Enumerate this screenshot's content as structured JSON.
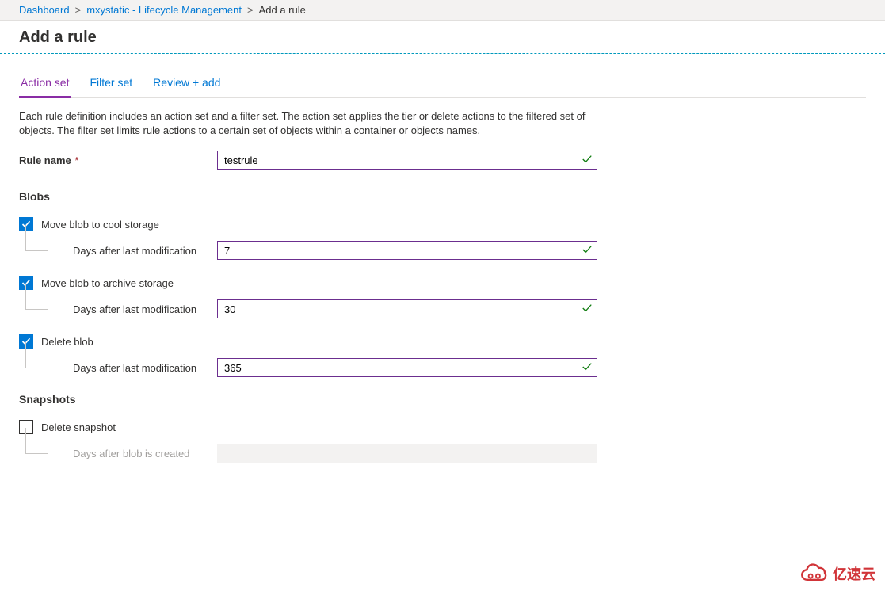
{
  "breadcrumb": {
    "items": [
      {
        "label": "Dashboard"
      },
      {
        "label": "mxystatic - Lifecycle Management"
      }
    ],
    "current": "Add a rule"
  },
  "page_title": "Add a rule",
  "tabs": [
    {
      "label": "Action set",
      "active": true
    },
    {
      "label": "Filter set",
      "active": false
    },
    {
      "label": "Review + add",
      "active": false
    }
  ],
  "description": "Each rule definition includes an action set and a filter set. The action set applies the tier or delete actions to the filtered set of objects. The filter set limits rule actions to a certain set of objects within a container or objects names.",
  "rule_name": {
    "label": "Rule name",
    "value": "testrule"
  },
  "blobs": {
    "heading": "Blobs",
    "cool": {
      "label": "Move blob to cool storage",
      "checked": true,
      "sub_label": "Days after last modification",
      "value": "7"
    },
    "archive": {
      "label": "Move blob to archive storage",
      "checked": true,
      "sub_label": "Days after last modification",
      "value": "30"
    },
    "delete": {
      "label": "Delete blob",
      "checked": true,
      "sub_label": "Days after last modification",
      "value": "365"
    }
  },
  "snapshots": {
    "heading": "Snapshots",
    "delete": {
      "label": "Delete snapshot",
      "checked": false,
      "sub_label": "Days after blob is created",
      "value": ""
    }
  },
  "watermark": "亿速云"
}
